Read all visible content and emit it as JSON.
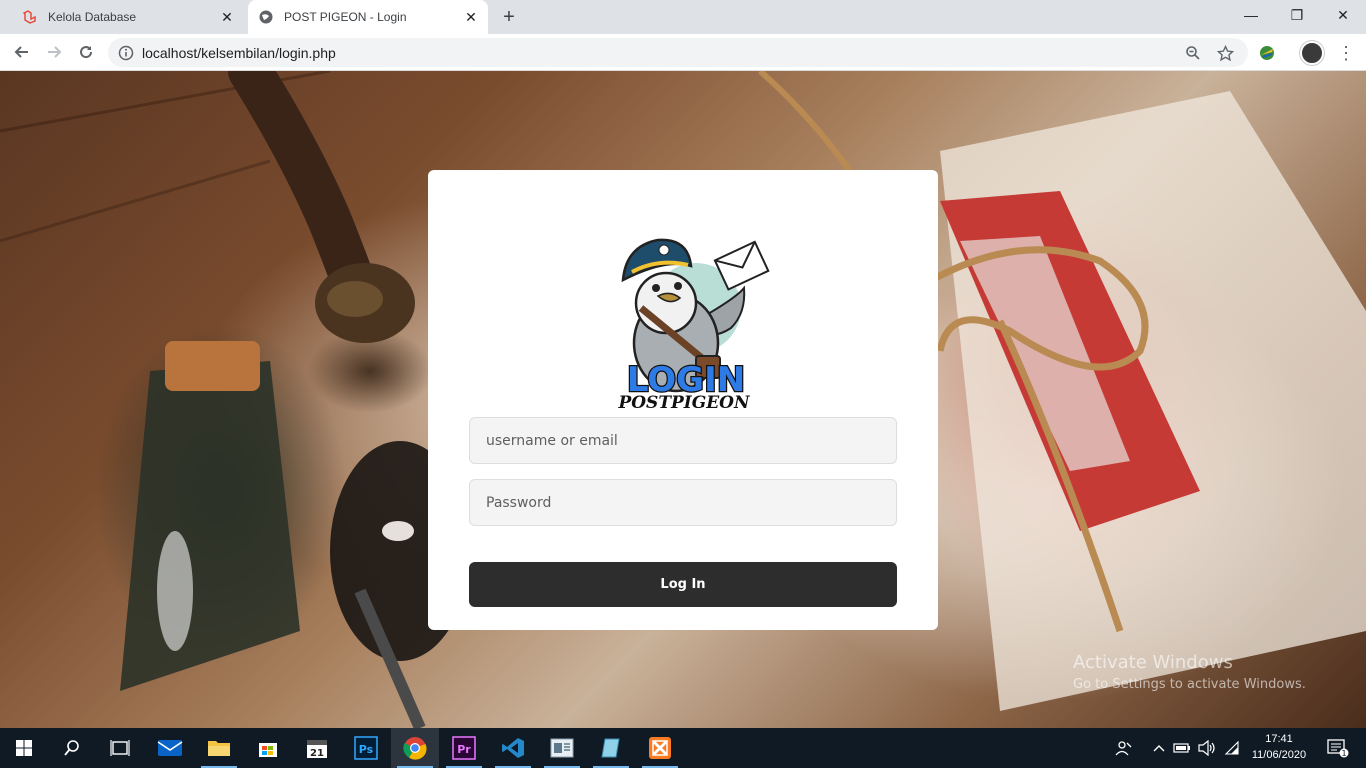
{
  "browser": {
    "tabs": [
      {
        "label": "Kelola Database",
        "favicon": "laravel-icon",
        "active": false
      },
      {
        "label": "POST PIGEON - Login",
        "favicon": "globe-icon",
        "active": true
      }
    ],
    "url": "localhost/kelsembilan/login.php"
  },
  "login": {
    "logo_title": "LOGIN",
    "logo_subtitle": "POSTPIGEON",
    "username_placeholder": "username or email",
    "password_placeholder": "Password",
    "button_label": "Log In"
  },
  "watermark": {
    "title": "Activate Windows",
    "subtitle": "Go to Settings to activate Windows."
  },
  "taskbar": {
    "apps": [
      "start-icon",
      "search-icon",
      "task-view-icon",
      "mail-icon",
      "file-explorer-icon",
      "store-icon",
      "calendar-icon",
      "photoshop-icon",
      "chrome-icon",
      "premiere-icon",
      "vscode-icon",
      "app-icon",
      "notepad-icon",
      "xampp-icon"
    ],
    "time": "17:41",
    "date": "11/06/2020",
    "notification_count": "1",
    "calendar_day": "21"
  },
  "colors": {
    "accent": "#2d2d2d",
    "taskbar": "#0f1a24",
    "logo_blue": "#2f7be6"
  }
}
